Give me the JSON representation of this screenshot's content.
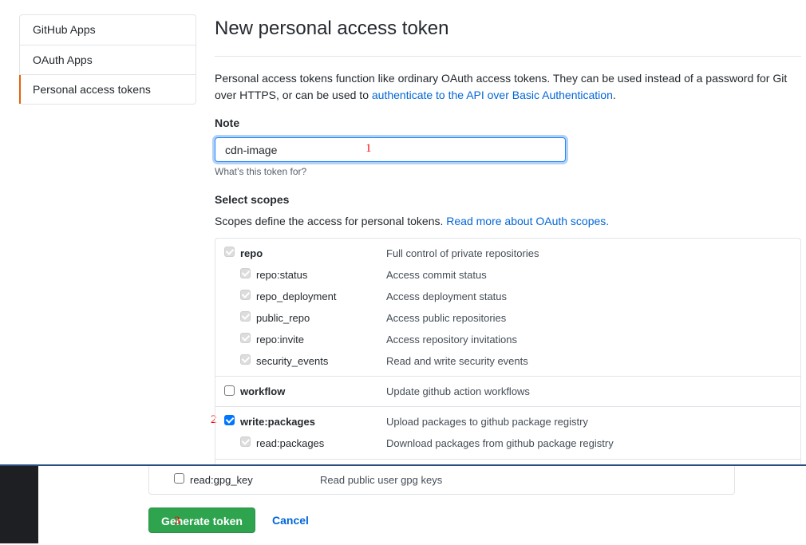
{
  "sidebar": {
    "items": [
      {
        "label": "GitHub Apps",
        "selected": false
      },
      {
        "label": "OAuth Apps",
        "selected": false
      },
      {
        "label": "Personal access tokens",
        "selected": true
      }
    ]
  },
  "page": {
    "title": "New personal access token",
    "intro_text": "Personal access tokens function like ordinary OAuth access tokens. They can be used instead of a password for Git over HTTPS, or can be used to ",
    "intro_link": "authenticate to the API over Basic Authentication",
    "intro_end": "."
  },
  "note": {
    "label": "Note",
    "value": "cdn-image",
    "hint": "What’s this token for?"
  },
  "scopes": {
    "label": "Select scopes",
    "description": "Scopes define the access for personal tokens. ",
    "link": "Read more about OAuth scopes.",
    "groups": [
      {
        "name": "repo",
        "description": "Full control of private repositories",
        "state": "disabled-checked",
        "children": [
          {
            "name": "repo:status",
            "description": "Access commit status",
            "state": "disabled-checked"
          },
          {
            "name": "repo_deployment",
            "description": "Access deployment status",
            "state": "disabled-checked"
          },
          {
            "name": "public_repo",
            "description": "Access public repositories",
            "state": "disabled-checked"
          },
          {
            "name": "repo:invite",
            "description": "Access repository invitations",
            "state": "disabled-checked"
          },
          {
            "name": "security_events",
            "description": "Read and write security events",
            "state": "disabled-checked"
          }
        ]
      },
      {
        "name": "workflow",
        "description": "Update github action workflows",
        "state": "unchecked",
        "children": []
      },
      {
        "name": "write:packages",
        "description": "Upload packages to github package registry",
        "state": "checked",
        "children": [
          {
            "name": "read:packages",
            "description": "Download packages from github package registry",
            "state": "disabled-checked"
          }
        ]
      }
    ],
    "gpg": {
      "name": "read:gpg_key",
      "description": "Read public user gpg keys",
      "state": "unchecked"
    }
  },
  "actions": {
    "generate_label": "Generate token",
    "cancel_label": "Cancel"
  },
  "annotations": {
    "marker_1": "1",
    "marker_2": "2",
    "marker_3": "3",
    "color": "#ff0000"
  },
  "colors": {
    "primary_button": "#2ea44f",
    "link": "#0366d6",
    "selected_indicator": "#e36209",
    "checkbox_checked": "#0075ff"
  }
}
